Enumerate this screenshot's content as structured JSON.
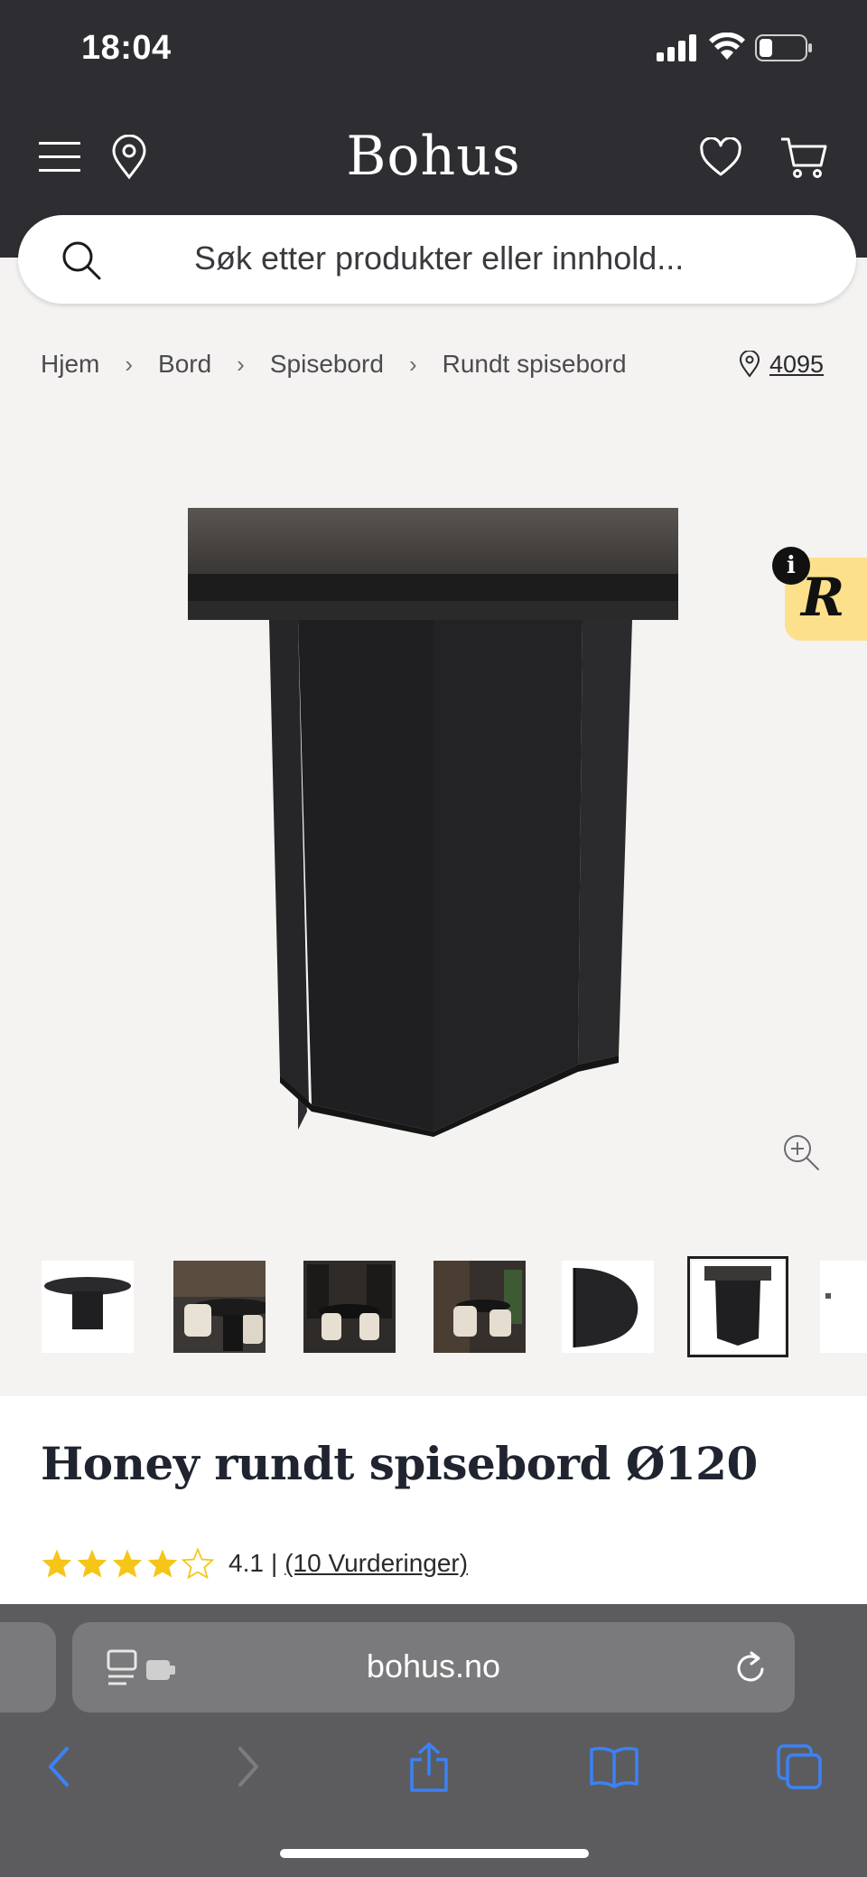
{
  "status_bar": {
    "time": "18:04"
  },
  "header": {
    "logo": "Bohus",
    "menu_icon": "hamburger-menu-icon",
    "location_icon": "location-pin-icon",
    "wishlist_icon": "heart-icon",
    "cart_icon": "shopping-cart-icon",
    "background": "#2e2d31"
  },
  "search": {
    "placeholder": "Søk etter produkter eller innhold..."
  },
  "breadcrumb": {
    "items": [
      "Hjem",
      "Bord",
      "Spisebord",
      "Rundt spisebord"
    ],
    "store_number": "4095"
  },
  "product": {
    "title": "Honey rundt spisebord Ø120",
    "rating_value": "4.1",
    "rating_separator": "|",
    "rating_link": "(10 Vurderinger)",
    "rating_stars": 4.1,
    "star_color": "#f5c518",
    "thumbnails_count": 7,
    "active_thumbnail": 6,
    "badge_letter": "R",
    "badge_info": "i",
    "badge_color": "#fde08b"
  },
  "browser": {
    "url": "bohus.no",
    "accent": "#3b82f6"
  }
}
